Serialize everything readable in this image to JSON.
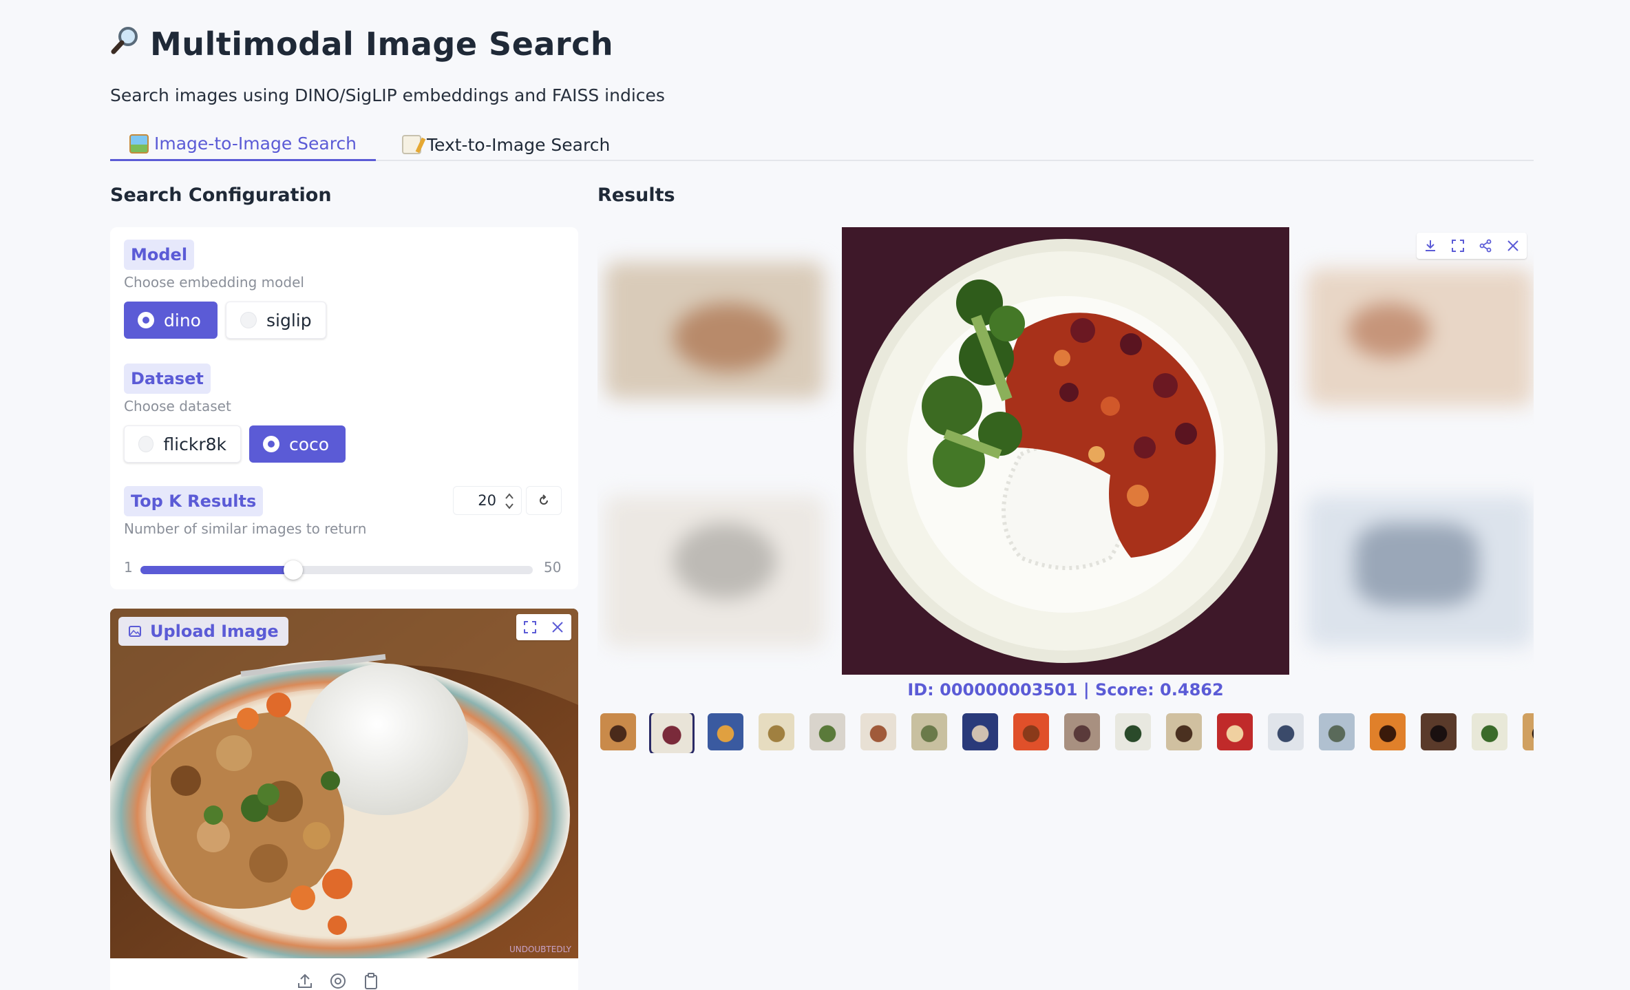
{
  "header": {
    "title": "Multimodal Image Search",
    "subtitle": "Search images using DINO/SigLIP embeddings and FAISS indices"
  },
  "tabs": [
    {
      "label": "Image-to-Image Search",
      "active": true
    },
    {
      "label": "Text-to-Image Search",
      "active": false
    }
  ],
  "config": {
    "section_title": "Search Configuration",
    "model": {
      "label": "Model",
      "info": "Choose embedding model",
      "options": [
        "dino",
        "siglip"
      ],
      "selected": "dino"
    },
    "dataset": {
      "label": "Dataset",
      "info": "Choose dataset",
      "options": [
        "flickr8k",
        "coco"
      ],
      "selected": "coco"
    },
    "topk": {
      "label": "Top K Results",
      "info": "Number of similar images to return",
      "value": "20",
      "min": "1",
      "max": "50",
      "fraction": 0.39
    }
  },
  "upload": {
    "label": "Upload Image",
    "watermark": "UNDOUBTEDLY"
  },
  "results": {
    "section_title": "Results",
    "caption": "ID: 000000003501 | Score: 0.4862",
    "thumb_count": 19,
    "selected_index": 1
  },
  "colors": {
    "accent": "#5b5bd6",
    "badge_bg": "#e6e8fb",
    "background": "#f7f8fb"
  },
  "icons": [
    "magnifier-icon",
    "framed-picture-icon",
    "memo-icon",
    "download-icon",
    "fullscreen-icon",
    "share-icon",
    "close-icon",
    "reset-icon",
    "upload-icon",
    "webcam-icon",
    "clipboard-icon",
    "image-icon"
  ]
}
